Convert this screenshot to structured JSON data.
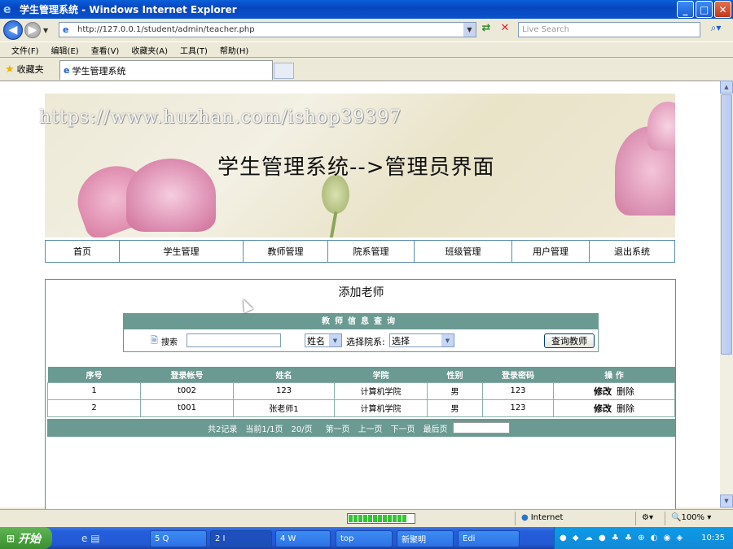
{
  "window": {
    "title": "学生管理系统 - Windows Internet Explorer"
  },
  "browser": {
    "url": "http://127.0.0.1/student/admin/teacher.php",
    "search_placeholder": "Live Search",
    "menu": [
      "文件(F)",
      "编辑(E)",
      "查看(V)",
      "收藏夹(A)",
      "工具(T)",
      "帮助(H)"
    ],
    "favorites_label": "收藏夹",
    "tab_title": "学生管理系统"
  },
  "page": {
    "watermark": "https://www.huzhan.com/ishop39397",
    "banner_title": "学生管理系统-->管理员界面",
    "nav": [
      "首页",
      "学生管理",
      "教师管理",
      "院系管理",
      "班级管理",
      "用户管理",
      "退出系统"
    ],
    "panel_title": "添加老师",
    "search": {
      "header": "教师信息查询",
      "label": "搜索",
      "field_value": "姓名",
      "dept_label": "选择院系:",
      "dept_value": "选择",
      "button": "查询教师"
    },
    "table": {
      "columns": [
        "序号",
        "登录帐号",
        "姓名",
        "学院",
        "性别",
        "登录密码",
        "操 作"
      ],
      "rows": [
        {
          "id": "1",
          "account": "t002",
          "name": "123",
          "dept": "计算机学院",
          "gender": "男",
          "password": "123",
          "edit": "修改",
          "delete": "删除"
        },
        {
          "id": "2",
          "account": "t001",
          "name": "张老师1",
          "dept": "计算机学院",
          "gender": "男",
          "password": "123",
          "edit": "修改",
          "delete": "删除"
        }
      ]
    },
    "pager": {
      "total": "共2记录",
      "current": "当前1/1页",
      "per_page": "20/页",
      "first": "第一页",
      "prev": "上一页",
      "next": "下一页",
      "last": "最后页"
    }
  },
  "status": {
    "zone": "Internet",
    "zoom": "100%",
    "progress": 1.0
  },
  "taskbar": {
    "start": "开始",
    "buttons": [
      "5 Q",
      "2 I",
      "4 W",
      "top",
      "新聚明",
      "Edi"
    ],
    "clock": "10:35"
  },
  "colors": {
    "accent": "#6a9a92",
    "border": "#5a8db0",
    "titlebar": "#0a52c9"
  }
}
